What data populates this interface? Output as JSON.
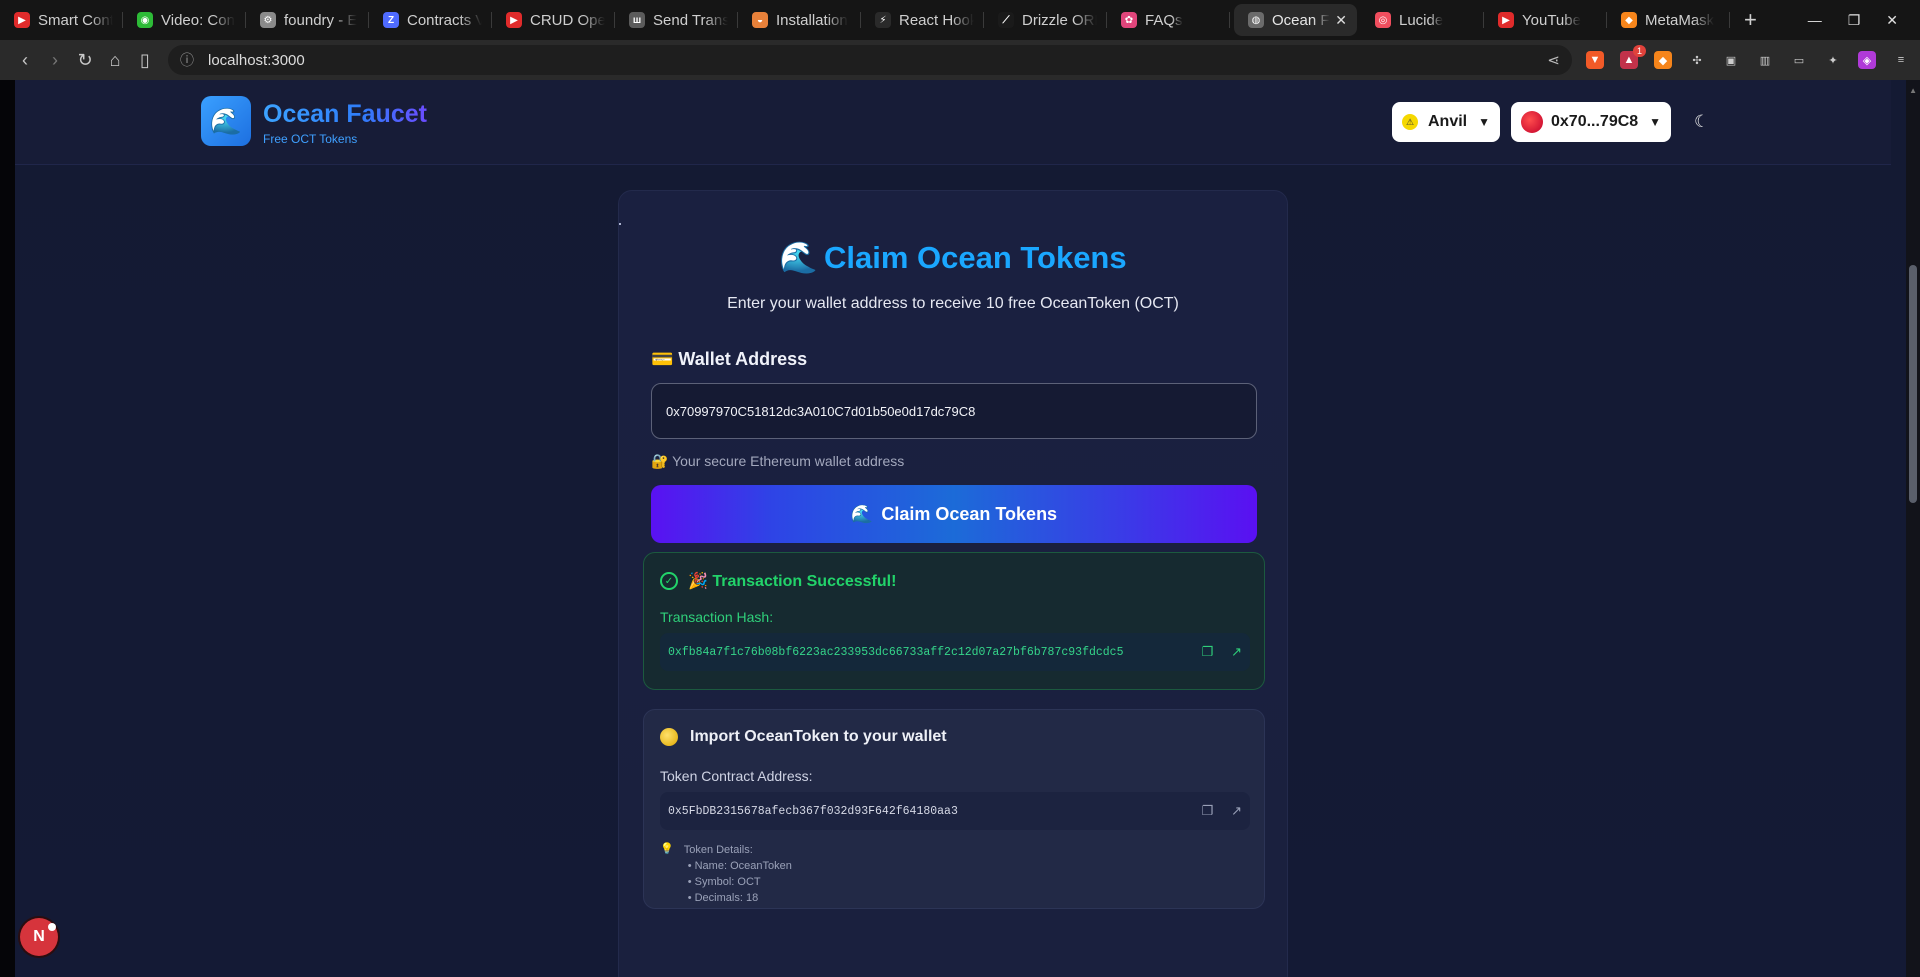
{
  "browser": {
    "tabs": [
      {
        "label": "Smart Cont",
        "color": "#e02b2b",
        "glyph": "▶"
      },
      {
        "label": "Video: Con",
        "color": "#2dbb37",
        "glyph": "◉"
      },
      {
        "label": "foundry - E",
        "color": "#8a8a8a",
        "glyph": "⚙"
      },
      {
        "label": "Contracts V",
        "color": "#4f6bff",
        "glyph": "Z"
      },
      {
        "label": "CRUD Oper",
        "color": "#e02b2b",
        "glyph": "▶"
      },
      {
        "label": "Send Trans",
        "color": "#5b5b5b",
        "glyph": "ш"
      },
      {
        "label": "Installation",
        "color": "#e8813a",
        "glyph": "◒"
      },
      {
        "label": "React Hook",
        "color": "#2a2a2a",
        "glyph": "⚡"
      },
      {
        "label": "Drizzle ORM",
        "color": "#1a1a1a",
        "glyph": "⟋"
      },
      {
        "label": "FAQs",
        "color": "#e0457b",
        "glyph": "✿"
      }
    ],
    "active_tab": {
      "label": "Ocean F",
      "close": "✕"
    },
    "tabs_after": [
      {
        "label": "Lucide",
        "color": "#f04e5e",
        "glyph": "◎"
      },
      {
        "label": "YouTube",
        "color": "#e02b2b",
        "glyph": "▶"
      },
      {
        "label": "MetaMask",
        "color": "#f6851b",
        "glyph": "◆"
      }
    ],
    "url": "localhost:3000",
    "shield_badge": "1"
  },
  "header": {
    "brand_title": "Ocean Faucet",
    "brand_subtitle": "Free OCT Tokens",
    "network_label": "Anvil",
    "account_label": "0x70...79C8"
  },
  "claim": {
    "title": "Claim Ocean Tokens",
    "subtitle": "Enter your wallet address to receive 10 free OceanToken (OCT)",
    "wallet_label": "💳 Wallet Address",
    "wallet_value": "0x70997970C51812dc3A010C7d01b50e0d17dc79C8",
    "wallet_hint": "🔐 Your secure Ethereum wallet address",
    "button_label": "Claim Ocean Tokens"
  },
  "success": {
    "title": "🎉 Transaction Successful!",
    "hash_label": "Transaction Hash:",
    "hash_value": "0xfb84a7f1c76b08bf6223ac233953dc66733aff2c12d07a27bf6b787c93fdcdc5"
  },
  "import": {
    "title": "Import OceanToken to your wallet",
    "address_label": "Token Contract Address:",
    "address_value": "0x5FbDB2315678afecb367f032d93F642f64180aa3",
    "details_title": "Token Details:",
    "details": [
      "• Name: OceanToken",
      "• Symbol: OCT",
      "• Decimals: 18"
    ]
  },
  "next_indicator": "N"
}
